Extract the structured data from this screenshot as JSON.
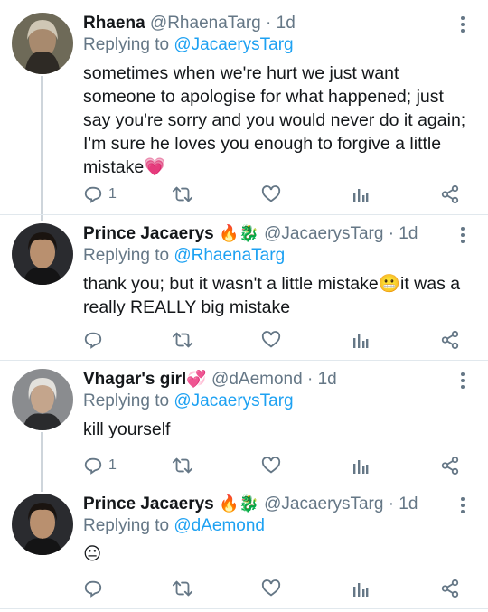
{
  "tweets": [
    {
      "name": "Rhaena",
      "name_emoji": "",
      "handle": "@RhaenaTarg",
      "time": "1d",
      "reply_prefix": "Replying to ",
      "reply_to": "@JacaerysTarg",
      "text": "sometimes when we're hurt we just want someone to apologise for what happened; just say you're sorry and you would never do it again; I'm sure he loves you enough to forgive a little mistake💗",
      "reply_count": "1"
    },
    {
      "name": "Prince Jacaerys",
      "name_emoji": "🔥🐉",
      "handle": "@JacaerysTarg",
      "time": "1d",
      "reply_prefix": "Replying to ",
      "reply_to": "@RhaenaTarg",
      "text": "thank you; but it wasn't a little mistake😬it was a really REALLY big mistake",
      "reply_count": ""
    },
    {
      "name": "Vhagar's girl",
      "name_emoji": "💞",
      "handle": "@dAemond",
      "time": "1d",
      "reply_prefix": "Replying to ",
      "reply_to": "@JacaerysTarg",
      "text": "kill yourself",
      "reply_count": "1"
    },
    {
      "name": "Prince Jacaerys",
      "name_emoji": "🔥🐉",
      "handle": "@JacaerysTarg",
      "time": "1d",
      "reply_prefix": "Replying to ",
      "reply_to": "@dAemond",
      "text": "😐",
      "reply_count": ""
    }
  ],
  "separator": "·",
  "icons": {
    "reply": "reply-icon",
    "retweet": "retweet-icon",
    "like": "heart-icon",
    "analytics": "analytics-icon",
    "share": "share-icon",
    "more": "more-vertical-icon"
  },
  "colors": {
    "mention": "#1da1f2",
    "secondary_text": "#657786",
    "thread_line": "#ced5db",
    "divider": "#e1e8ed"
  }
}
